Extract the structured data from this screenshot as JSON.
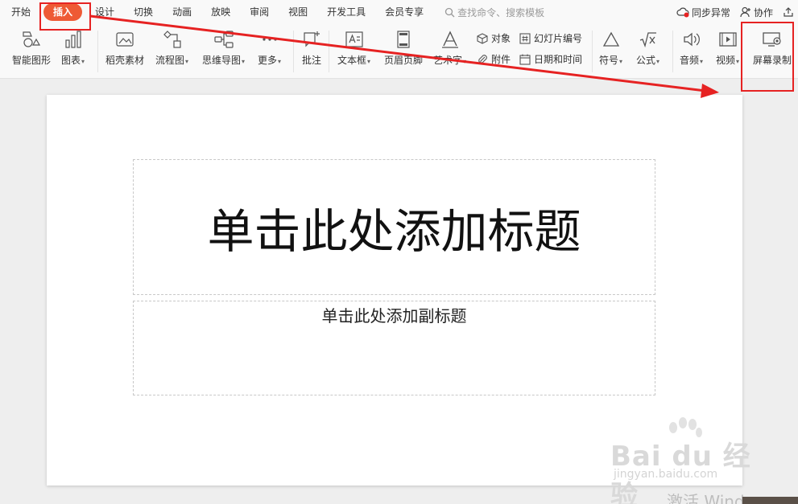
{
  "menu": {
    "items": [
      "开始",
      "插入",
      "设计",
      "切换",
      "动画",
      "放映",
      "审阅",
      "视图",
      "开发工具",
      "会员专享"
    ],
    "active_index": 1,
    "search_placeholder": "查找命令、搜索模板",
    "right": {
      "sync": "同步异常",
      "collab": "协作"
    }
  },
  "ribbon": {
    "smart_shape": "智能图形",
    "chart": "图表",
    "daoke": "稻壳素材",
    "flowchart": "流程图",
    "mindmap": "思维导图",
    "more": "更多",
    "comment": "批注",
    "textbox": "文本框",
    "header_footer": "页眉页脚",
    "wordart": "艺术字",
    "object": "对象",
    "attachment": "附件",
    "slide_number": "幻灯片编号",
    "datetime": "日期和时间",
    "symbol": "符号",
    "formula": "公式",
    "audio": "音频",
    "video": "视频",
    "screen_record": "屏幕录制"
  },
  "slide": {
    "title_placeholder": "单击此处添加标题",
    "subtitle_placeholder": "单击此处添加副标题"
  },
  "watermark": {
    "main": "Bai du 经验",
    "sub": "jingyan.baidu.com"
  },
  "activate_text": "激活 Windows",
  "colors": {
    "accent": "#ee5a35",
    "annotation": "#e62222"
  }
}
